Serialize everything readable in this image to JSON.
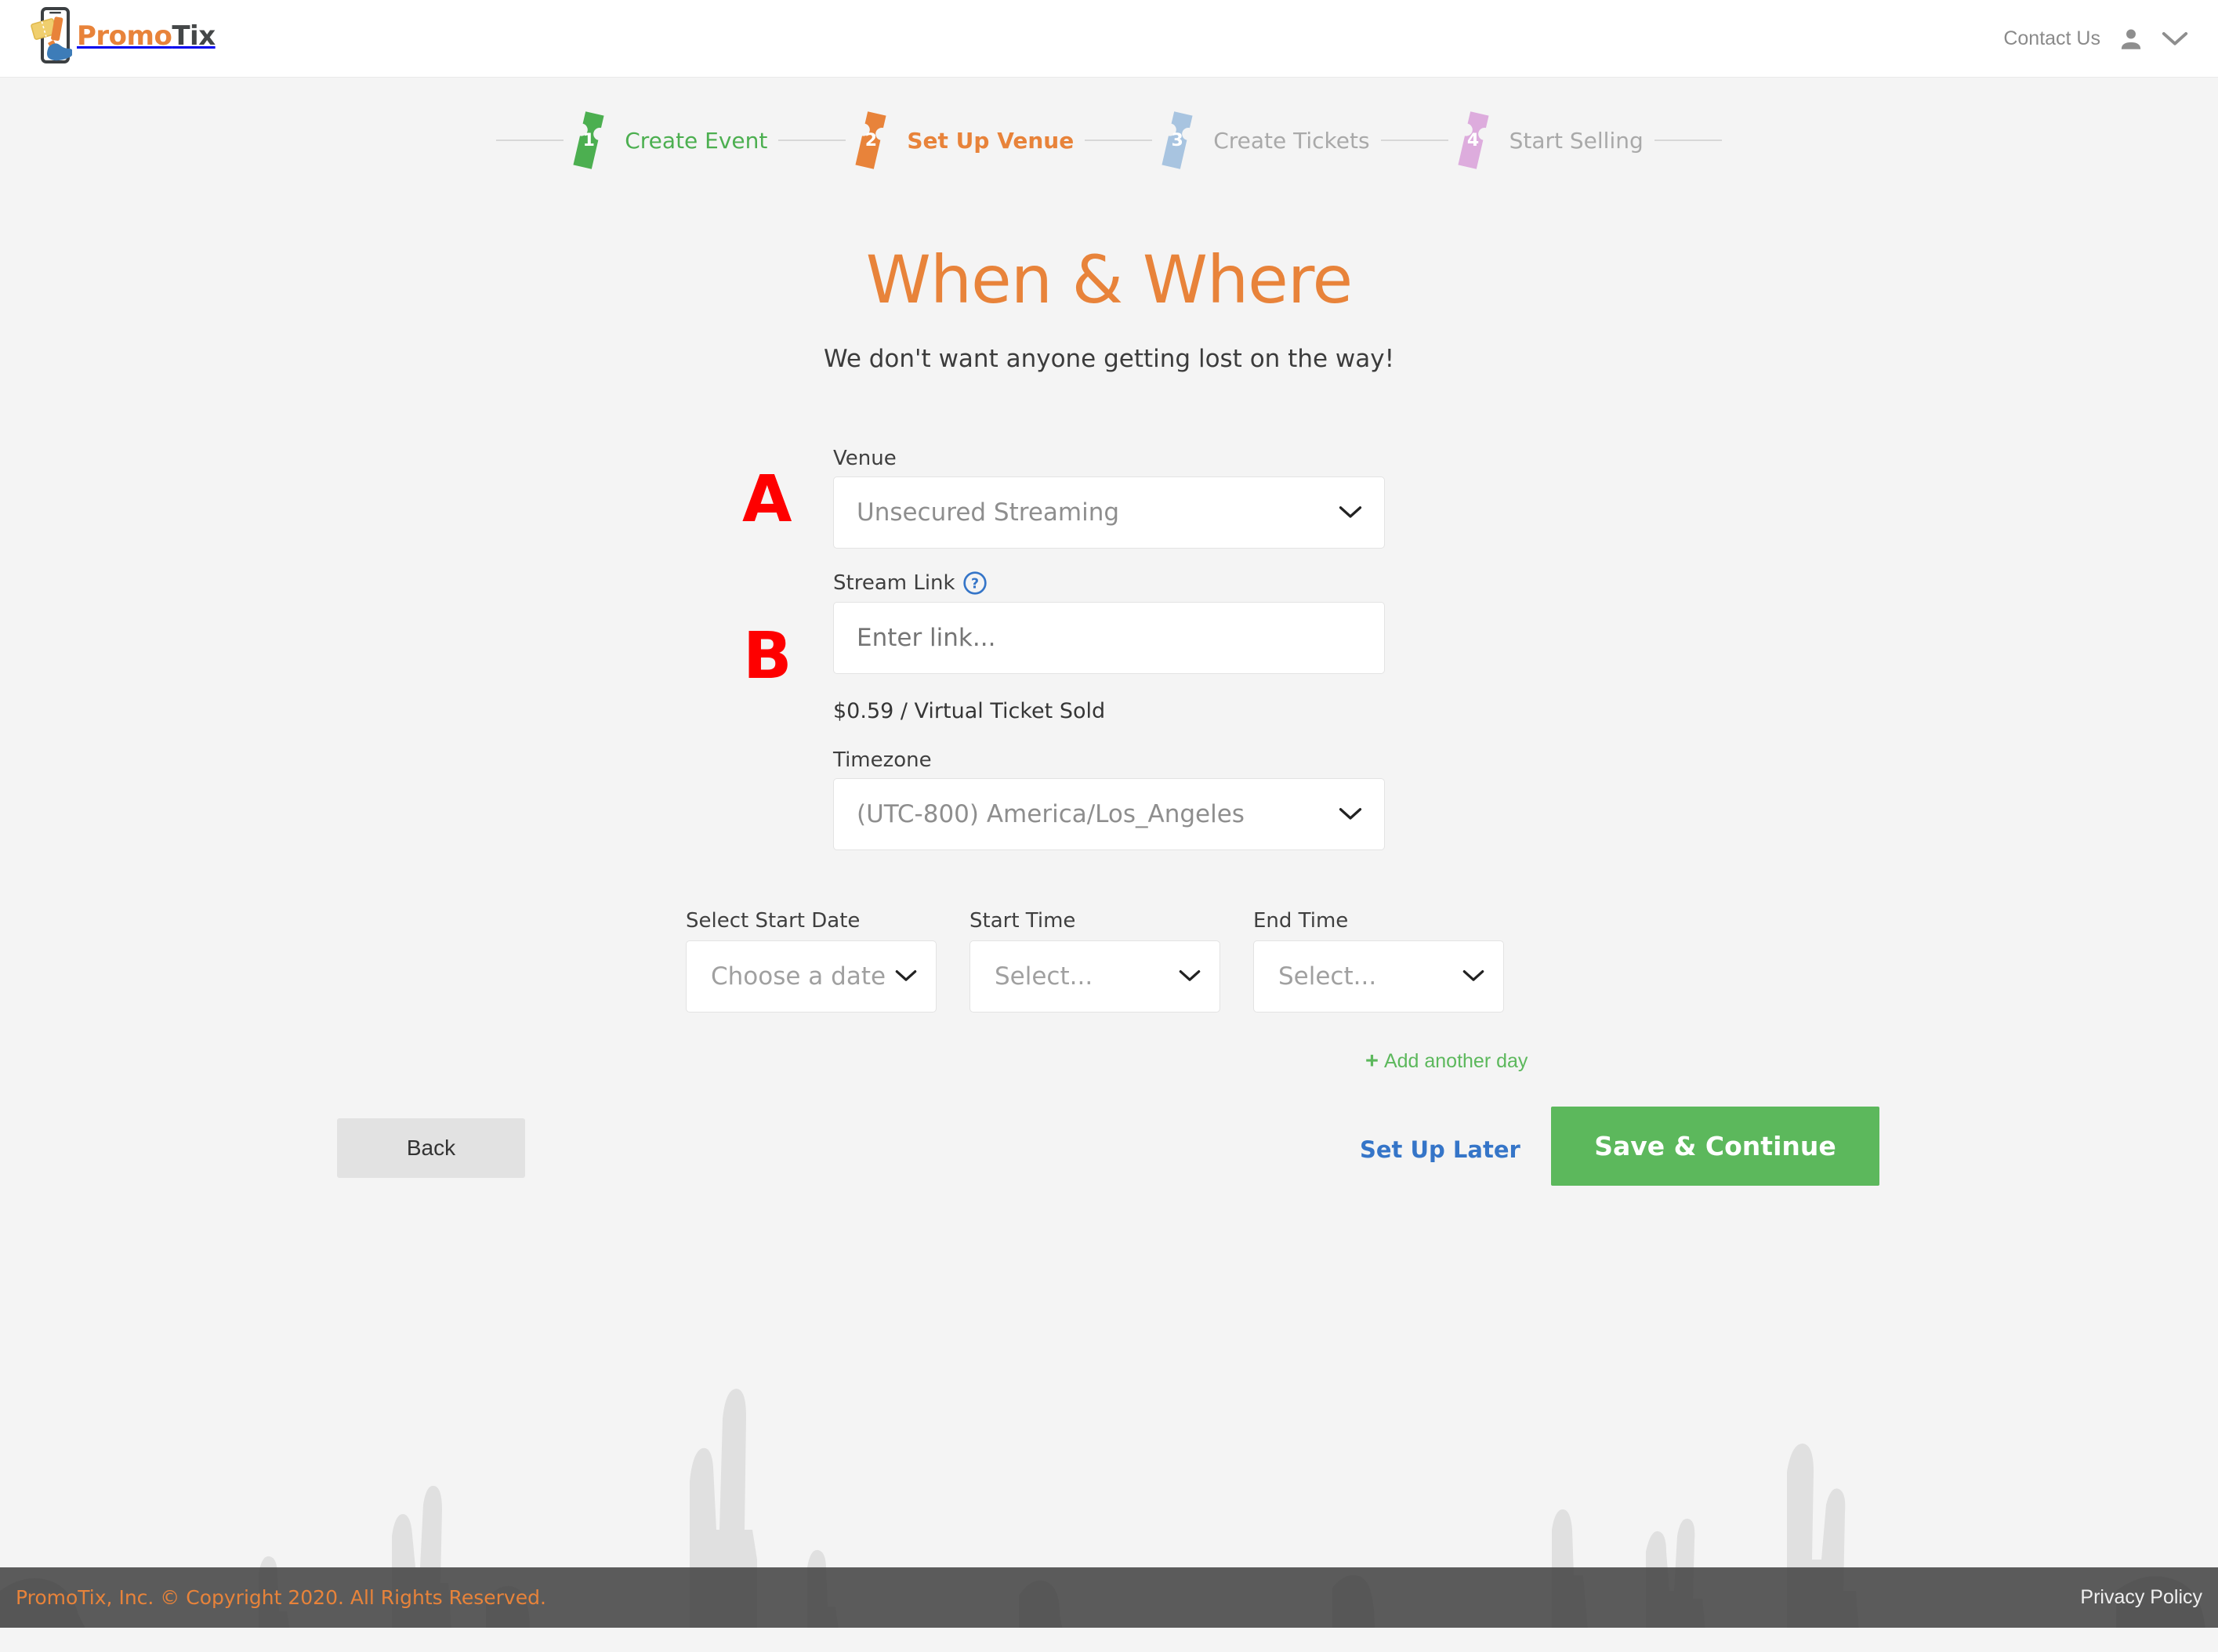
{
  "header": {
    "logo_promo": "Promo",
    "logo_tix": "Tix",
    "logo_icon": "phone-ticket-hand-icon",
    "contact_label": "Contact Us",
    "user_icon": "user-icon",
    "caret_icon": "chevron-down-icon"
  },
  "stepper": {
    "steps": [
      {
        "number": "1",
        "label": "Create Event",
        "state": "done",
        "color": "#4caf50"
      },
      {
        "number": "2",
        "label": "Set Up Venue",
        "state": "active",
        "color": "#e8833a"
      },
      {
        "number": "3",
        "label": "Create Tickets",
        "state": "todo",
        "color": "#a8c4e0"
      },
      {
        "number": "4",
        "label": "Start Selling",
        "state": "todo",
        "color": "#ddacdd"
      }
    ]
  },
  "page": {
    "title": "When & Where",
    "subtitle": "We don't want anyone getting lost on the way!"
  },
  "markers": {
    "a": "A",
    "b": "B"
  },
  "form": {
    "venue": {
      "label": "Venue",
      "value": "Unsecured Streaming"
    },
    "stream_link": {
      "label": "Stream Link",
      "help_icon": "question-mark-circle-icon",
      "placeholder": "Enter link...",
      "value": ""
    },
    "price_note": "$0.59 / Virtual Ticket Sold",
    "timezone": {
      "label": "Timezone",
      "value": "(UTC-800) America/Los_Angeles"
    },
    "start_date": {
      "label": "Select Start Date",
      "value": "Choose a date"
    },
    "start_time": {
      "label": "Start Time",
      "value": "Select..."
    },
    "end_time": {
      "label": "End Time",
      "value": "Select..."
    },
    "add_another_day": "Add another day",
    "add_another_day_icon": "plus-icon"
  },
  "actions": {
    "back": "Back",
    "set_up_later": "Set Up Later",
    "save_continue": "Save & Continue"
  },
  "footer": {
    "copyright": "PromoTix, Inc. © Copyright 2020. All Rights Reserved.",
    "privacy": "Privacy Policy"
  },
  "colors": {
    "brand_orange": "#e8833a",
    "green": "#5cb85c",
    "link_blue": "#3575c8",
    "marker_red": "#fe0000",
    "page_bg": "#f4f4f4"
  }
}
